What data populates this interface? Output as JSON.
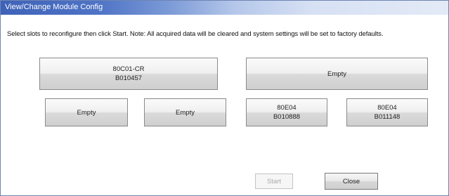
{
  "window": {
    "title": "View/Change Module Config"
  },
  "instructions": "Select slots to reconfigure then click Start. Note: All acquired data will be cleared and system settings will be set to factory defaults.",
  "slots": [
    {
      "line1": "80C01-CR",
      "line2": "B010457"
    },
    {
      "line1": "Empty",
      "line2": ""
    },
    {
      "line1": "Empty",
      "line2": ""
    },
    {
      "line1": "Empty",
      "line2": ""
    },
    {
      "line1": "80E04",
      "line2": "B010888"
    },
    {
      "line1": "80E04",
      "line2": "B011148"
    }
  ],
  "buttons": {
    "start_label": "Start",
    "start_enabled": false,
    "close_label": "Close"
  }
}
